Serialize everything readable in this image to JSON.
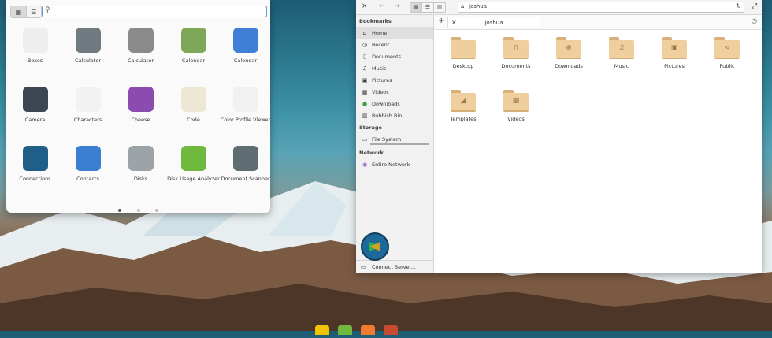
{
  "launcher": {
    "view_grid_icon": "grid-icon",
    "view_category_icon": "category-icon",
    "search": {
      "value": "",
      "placeholder": ""
    },
    "apps": [
      {
        "label": "Boxes",
        "color": "#eeeeee"
      },
      {
        "label": "Calculator",
        "color": "#6f7b80"
      },
      {
        "label": "Calculator",
        "color": "#8a8a8a"
      },
      {
        "label": "Calendar",
        "color": "#7ea857"
      },
      {
        "label": "Calendar",
        "color": "#3f7fd6"
      },
      {
        "label": "Camera",
        "color": "#3b4650"
      },
      {
        "label": "Characters",
        "color": "#f2f2f2"
      },
      {
        "label": "Cheese",
        "color": "#8b4bb0"
      },
      {
        "label": "Code",
        "color": "#efe7d6"
      },
      {
        "label": "Color Profile Viewer",
        "color": "#f1f1f1"
      },
      {
        "label": "Connections",
        "color": "#1f5f87"
      },
      {
        "label": "Contacts",
        "color": "#3a7fd0"
      },
      {
        "label": "Disks",
        "color": "#9da4a8"
      },
      {
        "label": "Disk Usage Analyzer",
        "color": "#6fb93f"
      },
      {
        "label": "Document Scanner",
        "color": "#5f6d72"
      }
    ],
    "pages": [
      true,
      false,
      false
    ]
  },
  "filemanager": {
    "close_icon": "×",
    "back_icon": "←",
    "forward_icon": "→",
    "address": "joshua",
    "reload_icon": "reload",
    "expand_icon": "expand",
    "tab_label": "joshua",
    "new_tab": "+",
    "tab_close": "×",
    "history_icon": "history",
    "sidebar": {
      "bookmarks_title": "Bookmarks",
      "bookmarks": [
        {
          "label": "Home",
          "icon": "home-icon",
          "selected": true
        },
        {
          "label": "Recent",
          "icon": "recent-icon"
        },
        {
          "label": "Documents",
          "icon": "documents-icon"
        },
        {
          "label": "Music",
          "icon": "music-icon"
        },
        {
          "label": "Pictures",
          "icon": "pictures-icon"
        },
        {
          "label": "Videos",
          "icon": "videos-icon"
        },
        {
          "label": "Downloads",
          "icon": "downloads-icon"
        },
        {
          "label": "Rubbish Bin",
          "icon": "trash-icon"
        }
      ],
      "storage_title": "Storage",
      "storage": [
        {
          "label": "File System",
          "icon": "drive-icon"
        }
      ],
      "network_title": "Network",
      "network": [
        {
          "label": "Entire Network",
          "icon": "network-icon"
        }
      ],
      "connect_label": "Connect Server..."
    },
    "folders": [
      {
        "label": "Desktop",
        "glyph": ""
      },
      {
        "label": "Documents",
        "glyph": "▯"
      },
      {
        "label": "Downloads",
        "glyph": "⊕"
      },
      {
        "label": "Music",
        "glyph": "♫"
      },
      {
        "label": "Pictures",
        "glyph": "▣"
      },
      {
        "label": "Public",
        "glyph": "⋖"
      },
      {
        "label": "Templates",
        "glyph": "◢"
      },
      {
        "label": "Videos",
        "glyph": "▦"
      }
    ]
  }
}
